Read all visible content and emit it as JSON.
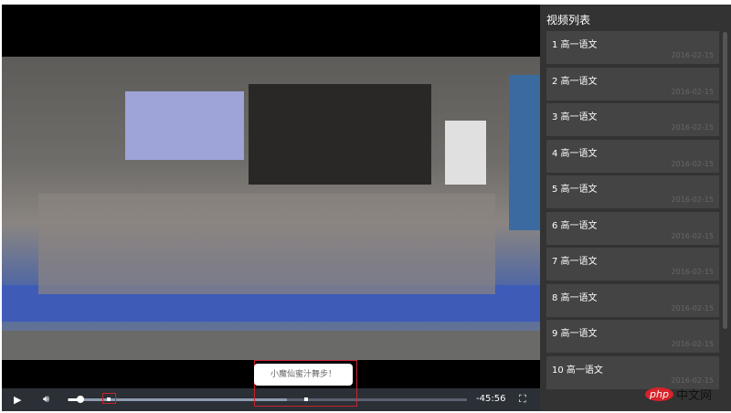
{
  "player": {
    "time_remaining": "-45:56",
    "tooltip": "小魔仙蜜汁舞步！",
    "progress_percent": 0.04,
    "buffered_percent": 55,
    "volume_percent": 20
  },
  "icons": {
    "play": "play-icon",
    "volume": "volume-icon",
    "fullscreen": "fullscreen-icon"
  },
  "sidebar": {
    "title": "视频列表",
    "items": [
      {
        "title": "1 高一语文",
        "date": "2016-02-15"
      },
      {
        "title": "2 高一语文",
        "date": "2016-02-15"
      },
      {
        "title": "3 高一语文",
        "date": "2016-02-15"
      },
      {
        "title": "4 高一语文",
        "date": "2016-02-15"
      },
      {
        "title": "5 高一语文",
        "date": "2016-02-15"
      },
      {
        "title": "6 高一语文",
        "date": "2016-02-15"
      },
      {
        "title": "7 高一语文",
        "date": "2016-02-15"
      },
      {
        "title": "8 高一语文",
        "date": "2016-02-15"
      },
      {
        "title": "9 高一语文",
        "date": "2016-02-15"
      },
      {
        "title": "10 高一语文",
        "date": "2016-02-15"
      }
    ]
  },
  "watermark": {
    "logo": "php",
    "text": "中文网"
  }
}
